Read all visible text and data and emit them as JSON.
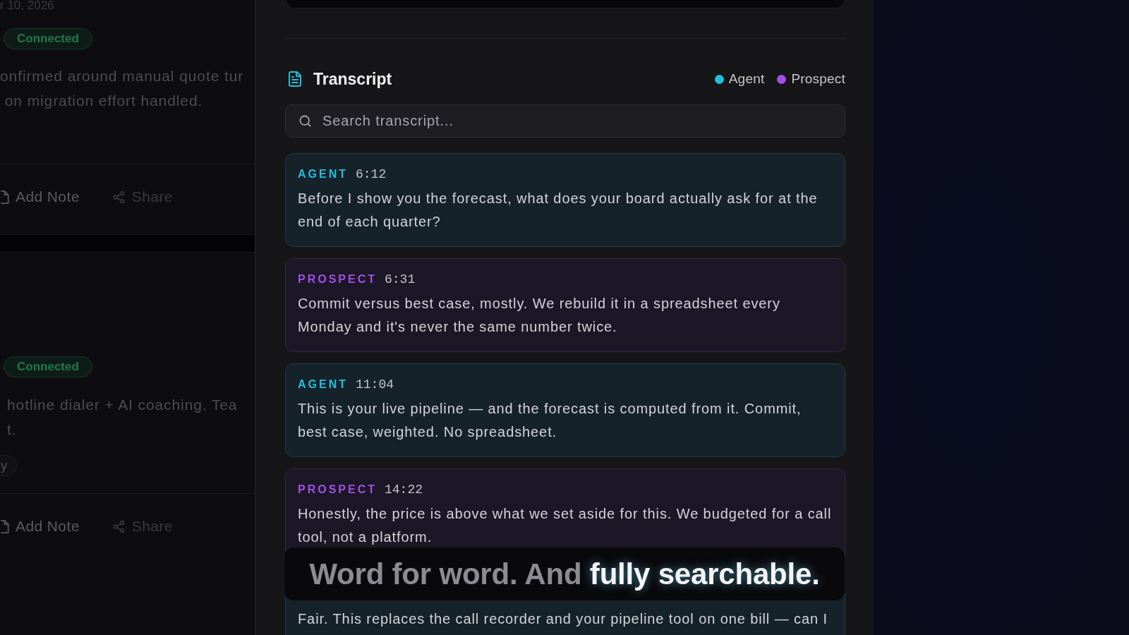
{
  "background_cards": [
    {
      "date": "r 10, 2026",
      "status": "Connected",
      "summary": [
        "onfirmed around manual quote tur",
        " on migration effort handled."
      ],
      "actions": [
        {
          "kind": "note",
          "label": "Add Note"
        },
        {
          "kind": "share",
          "label": "Share"
        }
      ]
    },
    {
      "status": "Connected",
      "summary": [
        "hotline dialer + AI coaching. Tea",
        "t."
      ],
      "tags": [
        "y"
      ],
      "actions": [
        {
          "kind": "note",
          "label": "Add Note"
        },
        {
          "kind": "share",
          "label": "Share"
        }
      ]
    }
  ],
  "transcript": {
    "title": "Transcript",
    "legend": [
      {
        "label": "Agent",
        "color": "#22bfdc"
      },
      {
        "label": "Prospect",
        "color": "#a24fe6"
      }
    ],
    "search": {
      "placeholder": "Search transcript..."
    },
    "messages": [
      {
        "kind": "agent",
        "speaker": "AGENT",
        "time": "6:12",
        "text": "Before I show you the forecast, what does your board actually ask for at the end of each quarter?"
      },
      {
        "kind": "prospect",
        "speaker": "PROSPECT",
        "time": "6:31",
        "text": "Commit versus best case, mostly. We rebuild it in a spreadsheet every Monday and it's never the same number twice."
      },
      {
        "kind": "agent",
        "speaker": "AGENT",
        "time": "11:04",
        "text": "This is your live pipeline — and the forecast is computed from it. Commit, best case, weighted. No spreadsheet."
      },
      {
        "kind": "prospect",
        "speaker": "PROSPECT",
        "time": "14:22",
        "text": "Honestly, the price is above what we set aside for this. We budgeted for a call tool, not a platform."
      },
      {
        "kind": "agent",
        "text": "Fair. This replaces the call recorder and your pipeline tool on one bill — can I"
      }
    ]
  },
  "caption": "Word for word. And **fully searchable.**"
}
